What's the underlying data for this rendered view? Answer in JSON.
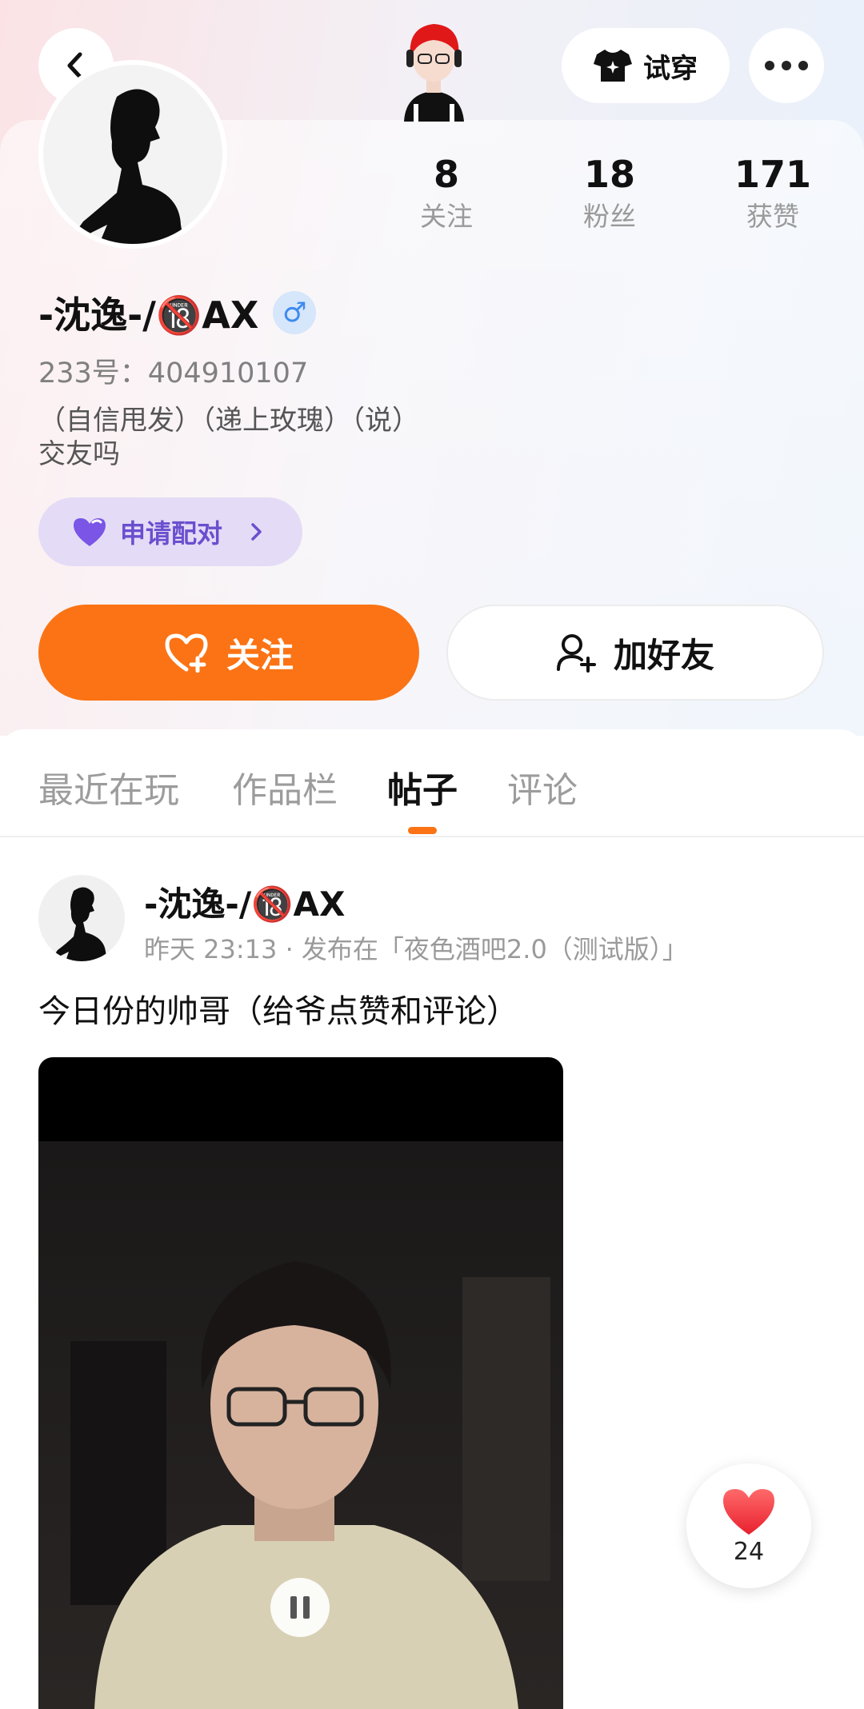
{
  "header": {
    "tryon_label": "试穿"
  },
  "profile": {
    "stats": [
      {
        "value": "8",
        "label": "关注"
      },
      {
        "value": "18",
        "label": "粉丝"
      },
      {
        "value": "171",
        "label": "获赞"
      }
    ],
    "username": "-沈逸-/🔞AX",
    "gender_symbol": "♂",
    "uid": "233号：404910107",
    "bio": "（自信甩发）（递上玫瑰）（说）\n交友吗",
    "pair_label": "申请配对"
  },
  "actions": {
    "follow_label": "关注",
    "add_friend_label": "加好友"
  },
  "tabs": [
    {
      "label": "最近在玩",
      "active": false
    },
    {
      "label": "作品栏",
      "active": false
    },
    {
      "label": "帖子",
      "active": true
    },
    {
      "label": "评论",
      "active": false
    }
  ],
  "post": {
    "author": "-沈逸-/🔞AX",
    "meta": "昨天 23:13 · 发布在「夜色酒吧2.0（测试版）」",
    "text": "今日份的帅哥（给爷点赞和评论）",
    "like_count": "24"
  },
  "colors": {
    "accent": "#fb7314",
    "pair_purple": "#6a4fcf",
    "like_red": "#f23a4a"
  },
  "icons": [
    "back-icon",
    "shirt-icon",
    "more-icon",
    "heart-icon",
    "follow-heart-icon",
    "add-user-icon",
    "pause-icon",
    "like-heart-icon"
  ]
}
